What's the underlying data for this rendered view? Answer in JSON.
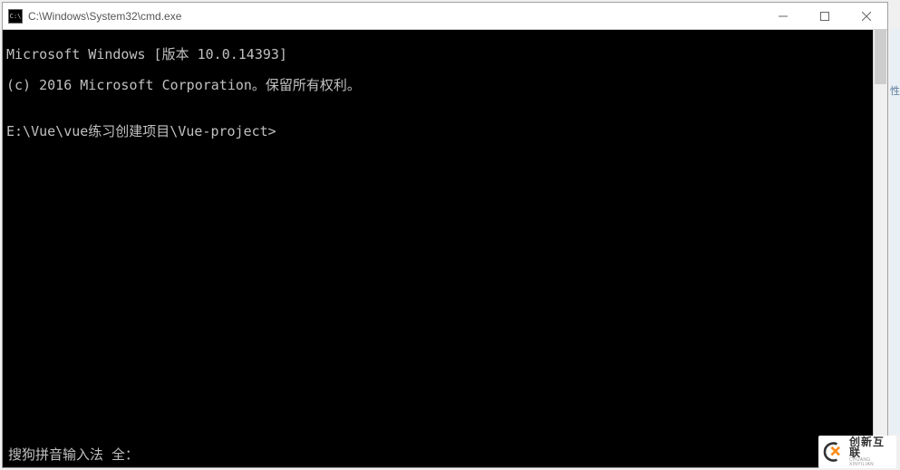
{
  "titlebar": {
    "icon_text": "C:\\",
    "path": "C:\\Windows\\System32\\cmd.exe"
  },
  "console": {
    "line1": "Microsoft Windows [版本 10.0.14393]",
    "line2": "(c) 2016 Microsoft Corporation。保留所有权利。",
    "blank": "",
    "prompt": "E:\\Vue\\vue练习创建项目\\Vue-project>"
  },
  "ime": {
    "text": "搜狗拼音输入法 全："
  },
  "side": {
    "char": "性"
  },
  "watermark": {
    "cn": "创新互联",
    "en": "CHUANG XINYILIAN"
  }
}
